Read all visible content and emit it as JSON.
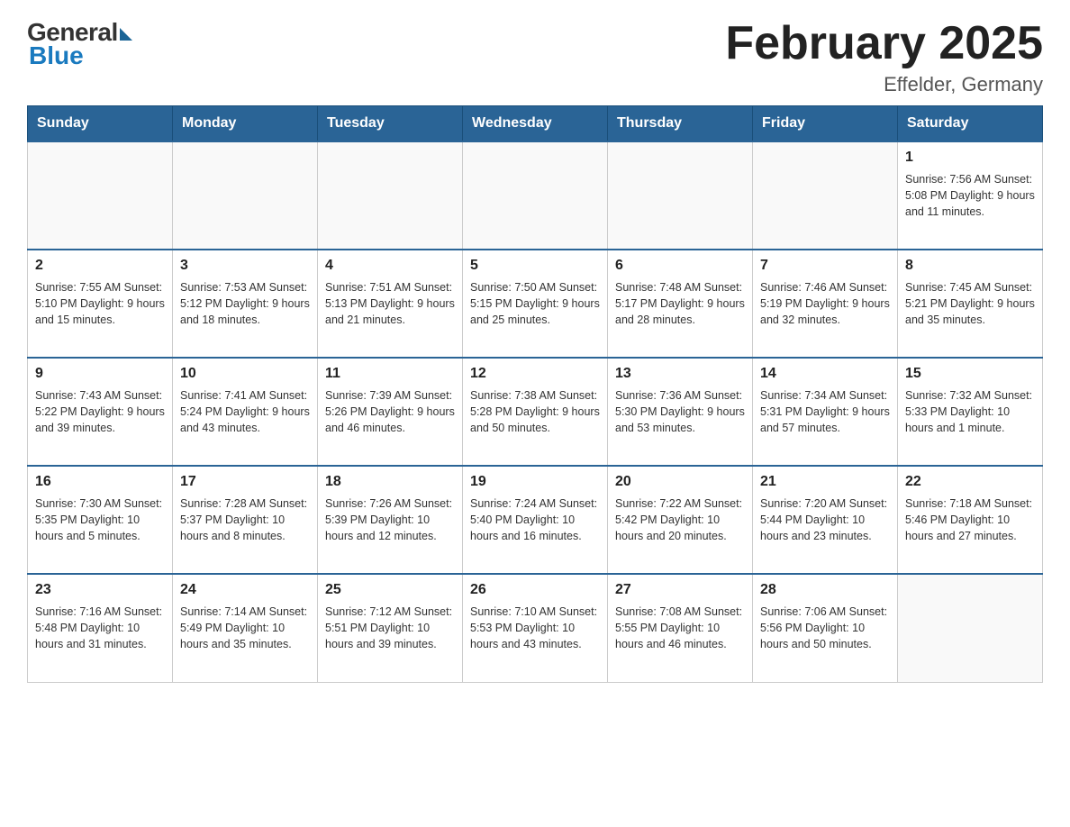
{
  "logo": {
    "general": "General",
    "blue": "Blue"
  },
  "title": "February 2025",
  "location": "Effelder, Germany",
  "days_of_week": [
    "Sunday",
    "Monday",
    "Tuesday",
    "Wednesday",
    "Thursday",
    "Friday",
    "Saturday"
  ],
  "weeks": [
    [
      {
        "day": "",
        "info": ""
      },
      {
        "day": "",
        "info": ""
      },
      {
        "day": "",
        "info": ""
      },
      {
        "day": "",
        "info": ""
      },
      {
        "day": "",
        "info": ""
      },
      {
        "day": "",
        "info": ""
      },
      {
        "day": "1",
        "info": "Sunrise: 7:56 AM\nSunset: 5:08 PM\nDaylight: 9 hours and 11 minutes."
      }
    ],
    [
      {
        "day": "2",
        "info": "Sunrise: 7:55 AM\nSunset: 5:10 PM\nDaylight: 9 hours and 15 minutes."
      },
      {
        "day": "3",
        "info": "Sunrise: 7:53 AM\nSunset: 5:12 PM\nDaylight: 9 hours and 18 minutes."
      },
      {
        "day": "4",
        "info": "Sunrise: 7:51 AM\nSunset: 5:13 PM\nDaylight: 9 hours and 21 minutes."
      },
      {
        "day": "5",
        "info": "Sunrise: 7:50 AM\nSunset: 5:15 PM\nDaylight: 9 hours and 25 minutes."
      },
      {
        "day": "6",
        "info": "Sunrise: 7:48 AM\nSunset: 5:17 PM\nDaylight: 9 hours and 28 minutes."
      },
      {
        "day": "7",
        "info": "Sunrise: 7:46 AM\nSunset: 5:19 PM\nDaylight: 9 hours and 32 minutes."
      },
      {
        "day": "8",
        "info": "Sunrise: 7:45 AM\nSunset: 5:21 PM\nDaylight: 9 hours and 35 minutes."
      }
    ],
    [
      {
        "day": "9",
        "info": "Sunrise: 7:43 AM\nSunset: 5:22 PM\nDaylight: 9 hours and 39 minutes."
      },
      {
        "day": "10",
        "info": "Sunrise: 7:41 AM\nSunset: 5:24 PM\nDaylight: 9 hours and 43 minutes."
      },
      {
        "day": "11",
        "info": "Sunrise: 7:39 AM\nSunset: 5:26 PM\nDaylight: 9 hours and 46 minutes."
      },
      {
        "day": "12",
        "info": "Sunrise: 7:38 AM\nSunset: 5:28 PM\nDaylight: 9 hours and 50 minutes."
      },
      {
        "day": "13",
        "info": "Sunrise: 7:36 AM\nSunset: 5:30 PM\nDaylight: 9 hours and 53 minutes."
      },
      {
        "day": "14",
        "info": "Sunrise: 7:34 AM\nSunset: 5:31 PM\nDaylight: 9 hours and 57 minutes."
      },
      {
        "day": "15",
        "info": "Sunrise: 7:32 AM\nSunset: 5:33 PM\nDaylight: 10 hours and 1 minute."
      }
    ],
    [
      {
        "day": "16",
        "info": "Sunrise: 7:30 AM\nSunset: 5:35 PM\nDaylight: 10 hours and 5 minutes."
      },
      {
        "day": "17",
        "info": "Sunrise: 7:28 AM\nSunset: 5:37 PM\nDaylight: 10 hours and 8 minutes."
      },
      {
        "day": "18",
        "info": "Sunrise: 7:26 AM\nSunset: 5:39 PM\nDaylight: 10 hours and 12 minutes."
      },
      {
        "day": "19",
        "info": "Sunrise: 7:24 AM\nSunset: 5:40 PM\nDaylight: 10 hours and 16 minutes."
      },
      {
        "day": "20",
        "info": "Sunrise: 7:22 AM\nSunset: 5:42 PM\nDaylight: 10 hours and 20 minutes."
      },
      {
        "day": "21",
        "info": "Sunrise: 7:20 AM\nSunset: 5:44 PM\nDaylight: 10 hours and 23 minutes."
      },
      {
        "day": "22",
        "info": "Sunrise: 7:18 AM\nSunset: 5:46 PM\nDaylight: 10 hours and 27 minutes."
      }
    ],
    [
      {
        "day": "23",
        "info": "Sunrise: 7:16 AM\nSunset: 5:48 PM\nDaylight: 10 hours and 31 minutes."
      },
      {
        "day": "24",
        "info": "Sunrise: 7:14 AM\nSunset: 5:49 PM\nDaylight: 10 hours and 35 minutes."
      },
      {
        "day": "25",
        "info": "Sunrise: 7:12 AM\nSunset: 5:51 PM\nDaylight: 10 hours and 39 minutes."
      },
      {
        "day": "26",
        "info": "Sunrise: 7:10 AM\nSunset: 5:53 PM\nDaylight: 10 hours and 43 minutes."
      },
      {
        "day": "27",
        "info": "Sunrise: 7:08 AM\nSunset: 5:55 PM\nDaylight: 10 hours and 46 minutes."
      },
      {
        "day": "28",
        "info": "Sunrise: 7:06 AM\nSunset: 5:56 PM\nDaylight: 10 hours and 50 minutes."
      },
      {
        "day": "",
        "info": ""
      }
    ]
  ]
}
